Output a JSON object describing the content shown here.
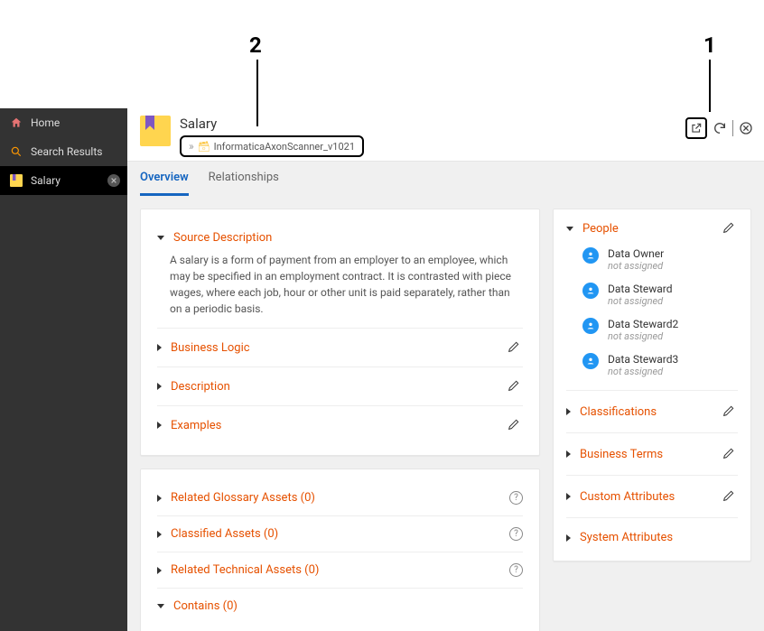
{
  "annotations": {
    "one": "1",
    "two": "2"
  },
  "sidebar": {
    "items": [
      {
        "label": "Home"
      },
      {
        "label": "Search Results"
      },
      {
        "label": "Salary"
      }
    ]
  },
  "header": {
    "title": "Salary",
    "breadcrumb": "InformaticaAxonScanner_v1021"
  },
  "tabs": [
    {
      "label": "Overview"
    },
    {
      "label": "Relationships"
    }
  ],
  "sections1": {
    "source_desc": {
      "title": "Source Description",
      "body": "A salary is a form of payment from an employer to an employee, which may be specified in an employment contract. It is contrasted with piece wages, where each job, hour or other unit is paid separately, rather than on a periodic basis."
    },
    "biz_logic": {
      "title": "Business Logic"
    },
    "desc": {
      "title": "Description"
    },
    "examples": {
      "title": "Examples"
    }
  },
  "sections2": {
    "glossary": {
      "title": "Related Glossary Assets (0)"
    },
    "classified": {
      "title": "Classified Assets (0)"
    },
    "technical": {
      "title": "Related Technical Assets (0)"
    },
    "contains": {
      "title": "Contains (0)"
    }
  },
  "right": {
    "people": {
      "title": "People",
      "items": [
        {
          "role": "Data Owner",
          "assign": "not assigned"
        },
        {
          "role": "Data Steward",
          "assign": "not assigned"
        },
        {
          "role": "Data Steward2",
          "assign": "not assigned"
        },
        {
          "role": "Data Steward3",
          "assign": "not assigned"
        }
      ]
    },
    "classifications": {
      "title": "Classifications"
    },
    "bterms": {
      "title": "Business Terms"
    },
    "custom": {
      "title": "Custom Attributes"
    },
    "system": {
      "title": "System Attributes"
    }
  }
}
